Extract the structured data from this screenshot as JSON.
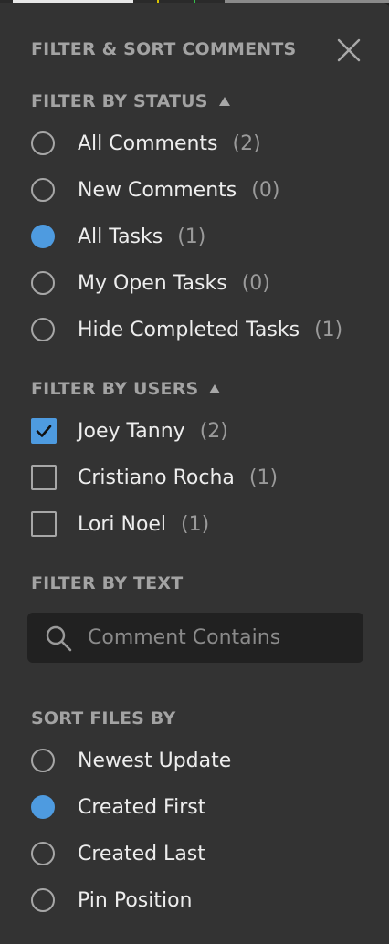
{
  "panel": {
    "title": "FILTER & SORT COMMENTS",
    "close_icon": "close-icon"
  },
  "filter_status": {
    "title": "FILTER BY STATUS",
    "options": [
      {
        "label": "All Comments",
        "count": "(2)",
        "selected": false
      },
      {
        "label": "New Comments",
        "count": "(0)",
        "selected": false
      },
      {
        "label": "All Tasks",
        "count": "(1)",
        "selected": true
      },
      {
        "label": "My Open Tasks",
        "count": "(0)",
        "selected": false
      },
      {
        "label": "Hide Completed Tasks",
        "count": "(1)",
        "selected": false
      }
    ]
  },
  "filter_users": {
    "title": "FILTER BY USERS",
    "options": [
      {
        "label": "Joey Tanny",
        "count": "(2)",
        "checked": true
      },
      {
        "label": "Cristiano Rocha",
        "count": "(1)",
        "checked": false
      },
      {
        "label": "Lori Noel",
        "count": "(1)",
        "checked": false
      }
    ]
  },
  "filter_text": {
    "title": "FILTER BY TEXT",
    "placeholder": "Comment Contains",
    "value": ""
  },
  "sort": {
    "title": "SORT FILES BY",
    "options": [
      {
        "label": "Newest Update",
        "selected": false
      },
      {
        "label": "Created First",
        "selected": true
      },
      {
        "label": "Created Last",
        "selected": false
      },
      {
        "label": "Pin Position",
        "selected": false
      }
    ]
  },
  "colors": {
    "panel_bg": "#333333",
    "accent": "#4e9be0",
    "heading": "#a3a3a3",
    "text": "#ededed",
    "count": "#9a9a9a",
    "input_bg": "#212121"
  }
}
